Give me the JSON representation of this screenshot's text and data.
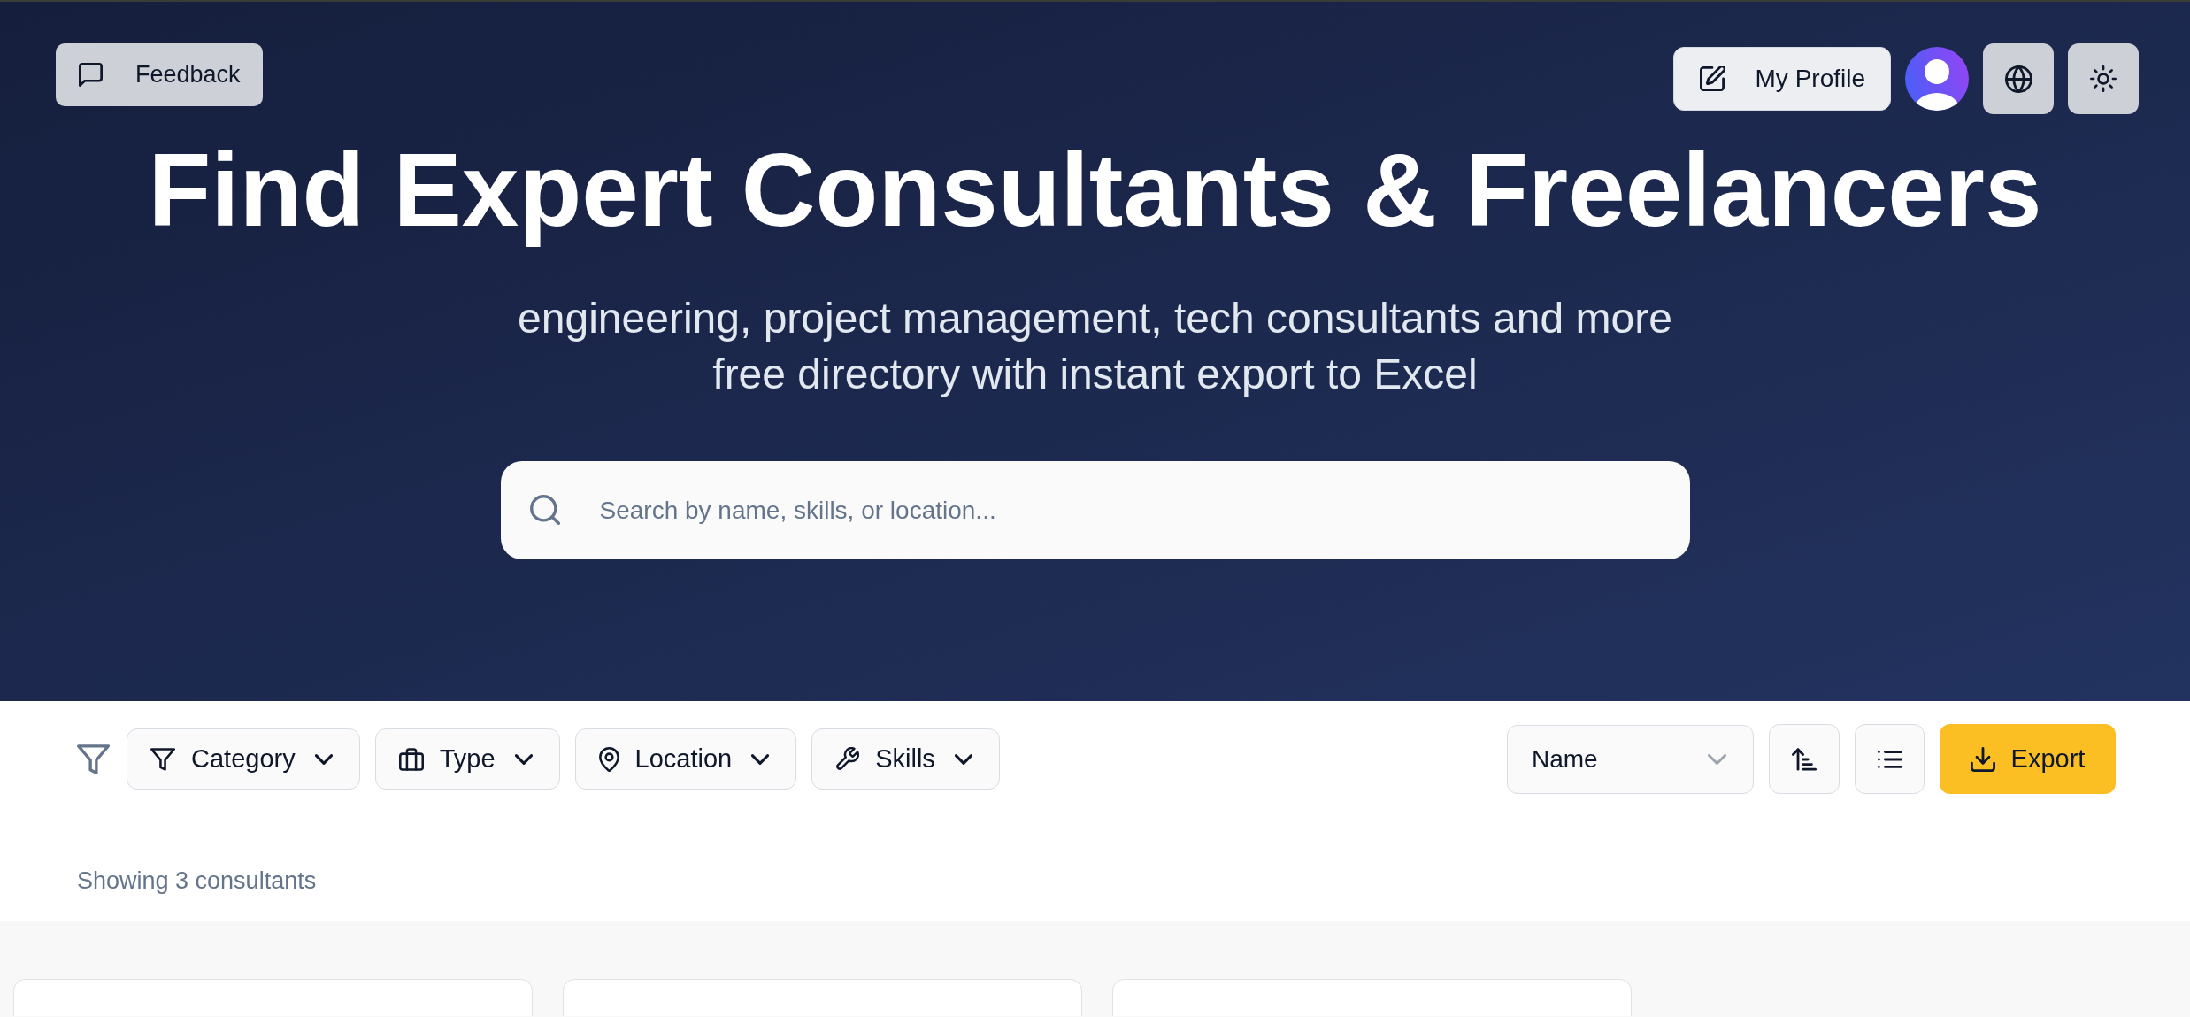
{
  "header": {
    "feedback_button": {
      "label": "Feedback"
    },
    "profile_button": {
      "label": "My Profile"
    },
    "title": "Find Expert Consultants & Freelancers",
    "subtitle_lines": [
      "engineering, project management, tech consultants and more",
      "free directory with instant export to Excel"
    ],
    "search": {
      "placeholder": "Search by name, skills, or location..."
    }
  },
  "filters": [
    {
      "label": "Category"
    },
    {
      "label": "Type"
    },
    {
      "label": "Location"
    },
    {
      "label": "Skills"
    }
  ],
  "sort_select": {
    "value": "Name"
  },
  "export_button": {
    "label": "Export"
  },
  "results_summary": "Showing 3 consultants"
}
